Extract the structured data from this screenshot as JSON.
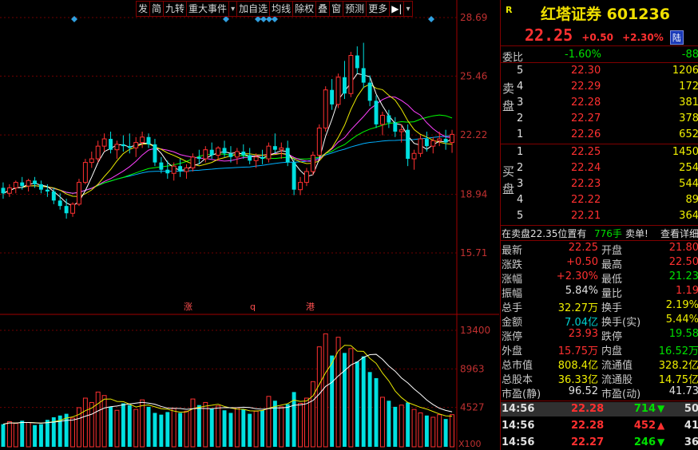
{
  "toolbar": {
    "items": [
      "发",
      "简",
      "九转",
      "重大事件",
      "▾",
      "加自选",
      "均线",
      "除权",
      "叠",
      "窗",
      "预测",
      "更多",
      "▾"
    ]
  },
  "chart": {
    "price_ticks": [
      "28.69",
      "25.46",
      "22.22",
      "18.94",
      "15.71"
    ],
    "volume_ticks": [
      "13400",
      "8963",
      "4527"
    ],
    "volume_unit": "X100",
    "markers": [
      "涨",
      "q",
      "港"
    ]
  },
  "chart_data": {
    "type": "candlestick",
    "title": "",
    "ylim": [
      12.5,
      28.69
    ],
    "volume_ylim": [
      0,
      13400
    ],
    "colors": {
      "up": "#ff3030",
      "down": "#00e0e0",
      "ma5": "#ffffff",
      "ma10": "#e8e800",
      "ma20": "#ff40ff",
      "ma30": "#00ff00",
      "ma60": "#00b0ff"
    },
    "ohlc": [
      [
        19.3,
        19.6,
        18.7,
        19.0
      ],
      [
        19.0,
        19.5,
        18.8,
        19.3
      ],
      [
        19.3,
        19.7,
        19.0,
        19.6
      ],
      [
        19.6,
        19.9,
        19.2,
        19.4
      ],
      [
        19.4,
        19.8,
        19.1,
        19.7
      ],
      [
        19.7,
        19.9,
        19.3,
        19.5
      ],
      [
        19.5,
        19.7,
        19.0,
        19.2
      ],
      [
        19.2,
        19.5,
        18.8,
        19.1
      ],
      [
        19.1,
        19.3,
        18.4,
        18.6
      ],
      [
        18.6,
        19.0,
        18.1,
        18.3
      ],
      [
        18.3,
        18.7,
        17.6,
        17.9
      ],
      [
        17.9,
        18.5,
        17.7,
        18.4
      ],
      [
        18.4,
        19.8,
        18.3,
        19.6
      ],
      [
        19.6,
        20.9,
        19.5,
        20.7
      ],
      [
        20.7,
        21.3,
        20.4,
        20.9
      ],
      [
        20.9,
        21.9,
        20.7,
        21.6
      ],
      [
        21.6,
        22.3,
        21.3,
        22.0
      ],
      [
        22.0,
        22.4,
        21.2,
        21.4
      ],
      [
        21.4,
        21.9,
        20.9,
        21.7
      ],
      [
        21.7,
        22.2,
        21.3,
        21.6
      ],
      [
        21.6,
        22.3,
        21.2,
        21.5
      ],
      [
        21.5,
        22.1,
        21.0,
        21.8
      ],
      [
        21.8,
        22.4,
        21.5,
        22.1
      ],
      [
        22.1,
        22.3,
        21.5,
        21.7
      ],
      [
        21.7,
        22.0,
        20.5,
        20.7
      ],
      [
        20.7,
        21.0,
        20.1,
        20.3
      ],
      [
        20.3,
        20.8,
        19.8,
        20.1
      ],
      [
        20.1,
        20.7,
        19.7,
        20.5
      ],
      [
        20.5,
        20.9,
        19.9,
        20.2
      ],
      [
        20.2,
        20.6,
        19.8,
        20.4
      ],
      [
        20.4,
        21.2,
        20.2,
        21.0
      ],
      [
        21.0,
        21.4,
        20.6,
        20.9
      ],
      [
        20.9,
        21.6,
        20.7,
        21.4
      ],
      [
        21.4,
        21.8,
        20.9,
        21.1
      ],
      [
        21.1,
        21.6,
        20.8,
        21.5
      ],
      [
        21.5,
        21.9,
        21.0,
        21.2
      ],
      [
        21.2,
        21.6,
        20.7,
        21.0
      ],
      [
        21.0,
        21.5,
        20.6,
        21.3
      ],
      [
        21.3,
        21.7,
        20.9,
        21.1
      ],
      [
        21.1,
        21.5,
        20.6,
        20.8
      ],
      [
        20.8,
        21.2,
        20.4,
        21.0
      ],
      [
        21.0,
        21.4,
        20.6,
        20.9
      ],
      [
        20.9,
        21.8,
        20.7,
        21.6
      ],
      [
        21.6,
        22.3,
        21.2,
        21.4
      ],
      [
        21.4,
        21.8,
        20.9,
        21.5
      ],
      [
        21.5,
        21.9,
        20.5,
        20.7
      ],
      [
        20.7,
        20.9,
        18.9,
        19.2
      ],
      [
        19.2,
        19.9,
        18.9,
        19.6
      ],
      [
        19.6,
        20.4,
        19.4,
        20.2
      ],
      [
        20.2,
        21.3,
        20.0,
        21.1
      ],
      [
        21.1,
        22.8,
        21.0,
        22.6
      ],
      [
        22.6,
        24.9,
        22.4,
        24.7
      ],
      [
        24.7,
        25.3,
        23.6,
        23.9
      ],
      [
        23.9,
        25.6,
        23.7,
        25.4
      ],
      [
        25.4,
        26.3,
        24.2,
        24.5
      ],
      [
        24.5,
        26.8,
        24.3,
        26.6
      ],
      [
        26.6,
        27.1,
        25.6,
        25.9
      ],
      [
        25.9,
        27.3,
        24.8,
        25.1
      ],
      [
        25.1,
        25.5,
        23.8,
        24.1
      ],
      [
        24.1,
        24.4,
        22.6,
        22.8
      ],
      [
        22.8,
        23.5,
        22.2,
        23.3
      ],
      [
        23.3,
        23.6,
        22.6,
        22.9
      ],
      [
        22.9,
        23.2,
        22.1,
        22.4
      ],
      [
        22.4,
        22.8,
        21.8,
        22.5
      ],
      [
        22.5,
        22.8,
        20.5,
        20.9
      ],
      [
        20.9,
        21.4,
        20.3,
        21.2
      ],
      [
        21.2,
        22.2,
        21.0,
        22.0
      ],
      [
        22.0,
        22.4,
        21.3,
        21.6
      ],
      [
        21.6,
        22.1,
        21.2,
        21.9
      ],
      [
        21.9,
        22.4,
        21.6,
        22.0
      ],
      [
        22.0,
        22.5,
        21.4,
        21.8
      ],
      [
        21.8,
        22.5,
        21.23,
        22.25
      ]
    ],
    "volume": [
      2600,
      2900,
      2700,
      3000,
      2800,
      2500,
      2600,
      3100,
      3400,
      3600,
      3800,
      3300,
      4500,
      5600,
      5100,
      6300,
      5900,
      4600,
      4200,
      5000,
      4800,
      4300,
      5400,
      4600,
      3900,
      3700,
      4000,
      4400,
      3900,
      4100,
      5500,
      4800,
      5100,
      4400,
      4700,
      4200,
      3900,
      4500,
      4300,
      3800,
      4100,
      4200,
      5800,
      5300,
      4600,
      4900,
      6300,
      5000,
      5600,
      7500,
      11500,
      13000,
      10500,
      12600,
      10800,
      11300,
      9800,
      10400,
      8600,
      7900,
      5700,
      5300,
      4600,
      4800,
      5100,
      4300,
      3900,
      3600,
      3400,
      3700,
      3200,
      3700
    ]
  },
  "stock": {
    "r_mark": "R",
    "name_code": "红塔证券 601236",
    "price": "22.25",
    "change": "+0.50",
    "pct": "+2.30%",
    "badge": "陆",
    "weibi_label": "委比",
    "weibi_pct": "-1.60%",
    "weibi_val": "-88"
  },
  "asks": [
    {
      "lvl": "5",
      "price": "22.30",
      "vol": "1206"
    },
    {
      "lvl": "4",
      "price": "22.29",
      "vol": "172"
    },
    {
      "lvl": "3",
      "price": "22.28",
      "vol": "381"
    },
    {
      "lvl": "2",
      "price": "22.27",
      "vol": "378"
    },
    {
      "lvl": "1",
      "price": "22.26",
      "vol": "652"
    }
  ],
  "bids": [
    {
      "lvl": "1",
      "price": "22.25",
      "vol": "1450"
    },
    {
      "lvl": "2",
      "price": "22.24",
      "vol": "254"
    },
    {
      "lvl": "3",
      "price": "22.23",
      "vol": "544"
    },
    {
      "lvl": "4",
      "price": "22.22",
      "vol": "89"
    },
    {
      "lvl": "5",
      "price": "22.21",
      "vol": "364"
    }
  ],
  "ask_side_label": [
    "卖",
    "盘"
  ],
  "bid_side_label": [
    "买",
    "盘"
  ],
  "notice": {
    "text": "在卖盘22.35位置有",
    "vol": "776手",
    "action": "卖单!",
    "link": "查看详细"
  },
  "stats": [
    {
      "l1": "最新",
      "v1": "22.25",
      "c1": "red",
      "l2": "开盘",
      "v2": "21.80",
      "c2": "red"
    },
    {
      "l1": "涨跌",
      "v1": "+0.50",
      "c1": "red",
      "l2": "最高",
      "v2": "22.50",
      "c2": "red"
    },
    {
      "l1": "涨幅",
      "v1": "+2.30%",
      "c1": "red",
      "l2": "最低",
      "v2": "21.23",
      "c2": "green"
    },
    {
      "l1": "振幅",
      "v1": "5.84%",
      "c1": "white",
      "l2": "量比",
      "v2": "1.19",
      "c2": "red"
    },
    {
      "l1": "总手",
      "v1": "32.27万",
      "c1": "yel",
      "l2": "换手",
      "v2": "2.19%",
      "c2": "yel"
    },
    {
      "l1": "金额",
      "v1": "7.04亿",
      "c1": "cyan",
      "l2": "换手(实)",
      "v2": "5.44%",
      "c2": "yel"
    },
    {
      "l1": "涨停",
      "v1": "23.93",
      "c1": "red",
      "l2": "跌停",
      "v2": "19.58",
      "c2": "green"
    },
    {
      "l1": "外盘",
      "v1": "15.75万",
      "c1": "red",
      "l2": "内盘",
      "v2": "16.52万",
      "c2": "green"
    },
    {
      "l1": "总市值",
      "v1": "808.4亿",
      "c1": "yel",
      "l2": "流通值",
      "v2": "328.2亿",
      "c2": "yel"
    },
    {
      "l1": "总股本",
      "v1": "36.33亿",
      "c1": "yel",
      "l2": "流通股",
      "v2": "14.75亿",
      "c2": "yel"
    },
    {
      "l1": "市盈(静)",
      "v1": "96.52",
      "c1": "white",
      "l2": "市盈(动)",
      "v2": "41.73",
      "c2": "white"
    }
  ],
  "trades": [
    {
      "time": "14:56",
      "price": "22.28",
      "vol": "714",
      "dir": "down",
      "extra": "50"
    },
    {
      "time": "14:56",
      "price": "22.28",
      "vol": "452",
      "dir": "up",
      "extra": "41"
    },
    {
      "time": "14:56",
      "price": "22.27",
      "vol": "246",
      "dir": "down",
      "extra": "36"
    }
  ]
}
